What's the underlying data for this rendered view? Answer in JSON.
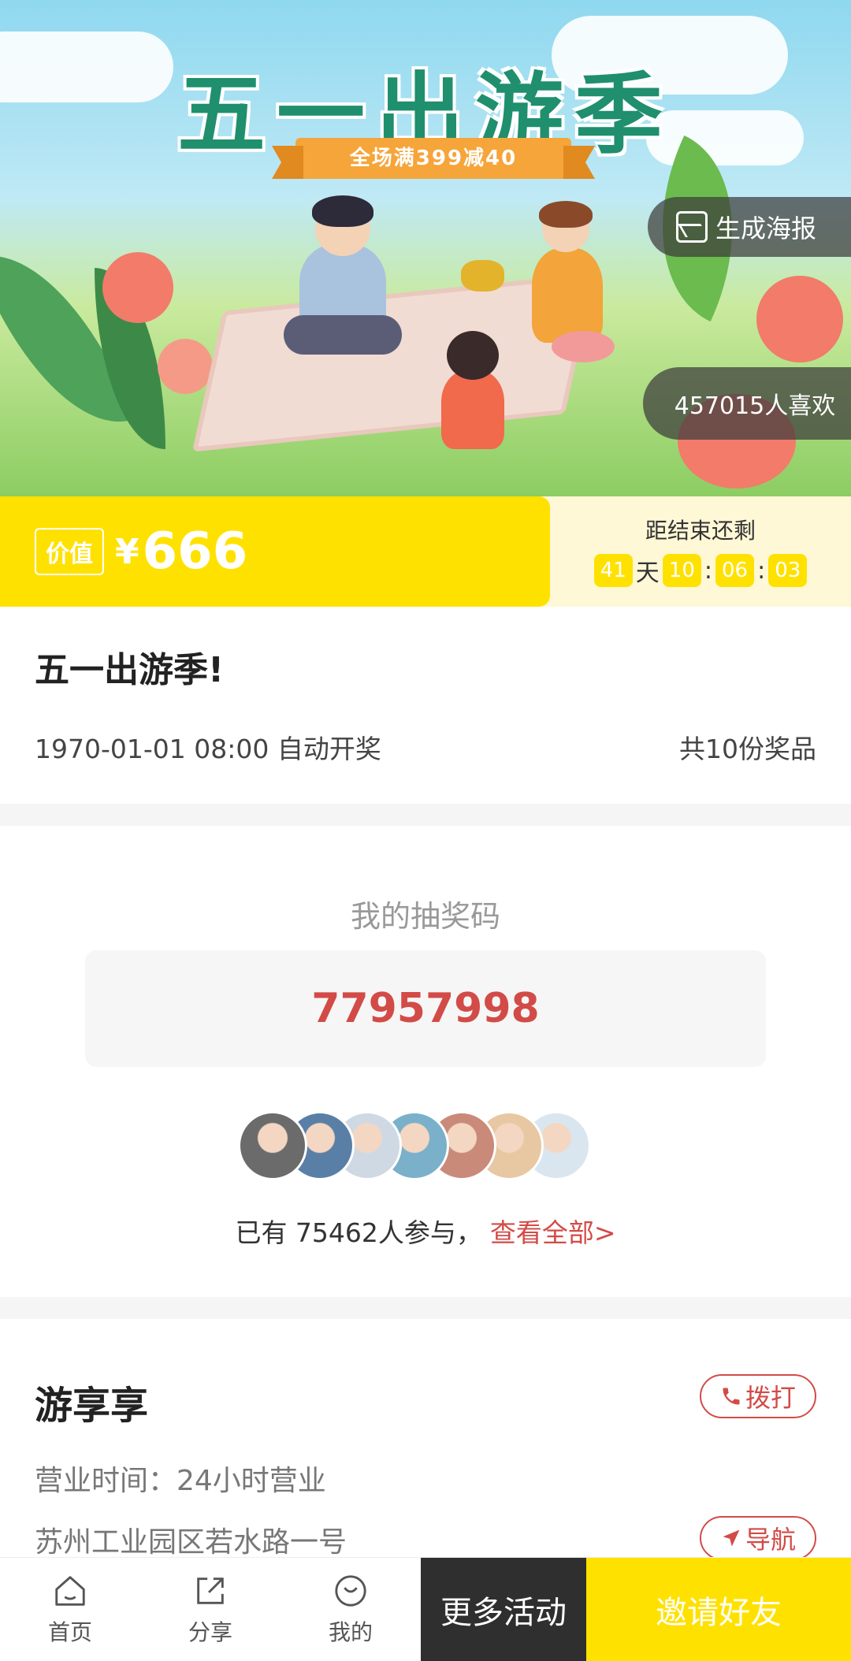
{
  "hero": {
    "title": "五一出游季",
    "ribbon": "全场满399减40",
    "poster_button": "生成海报",
    "likes": "457015人喜欢"
  },
  "price": {
    "badge": "价值",
    "currency": "¥",
    "amount": "666"
  },
  "countdown": {
    "label": "距结束还剩",
    "days": "41",
    "day_unit": "天",
    "hours": "10",
    "minutes": "06",
    "seconds": "03",
    "sep": ":"
  },
  "event": {
    "title": "五一出游季!",
    "draw_time": "1970-01-01 08:00 自动开奖",
    "prize_count": "共10份奖品"
  },
  "lottery": {
    "label": "我的抽奖码",
    "code": "77957998",
    "participants_text": "已有 75462人参与，",
    "view_all": "查看全部>",
    "avatar_colors": [
      "#6b6b6b",
      "#5a7fa6",
      "#cfd9e3",
      "#7ab0c9",
      "#c98a7a",
      "#e8c7a3",
      "#d9e6ef"
    ]
  },
  "shop": {
    "name": "游享享",
    "call_label": "拨打",
    "hours": "营业时间：24小时营业",
    "address": "苏州工业园区若水路一号",
    "nav_label": "导航"
  },
  "bottom_bar": {
    "home": "首页",
    "share": "分享",
    "mine": "我的",
    "more": "更多活动",
    "invite": "邀请好友"
  },
  "colors": {
    "accent_yellow": "#ffe100",
    "accent_red": "#d24b47",
    "dark_button": "#2f2f2f"
  }
}
